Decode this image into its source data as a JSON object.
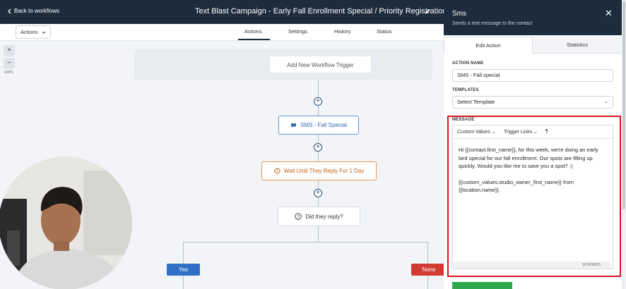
{
  "topbar": {
    "back_label": "Back to workflows",
    "title": "Text Blast Campaign - Early Fall Enrollment Special / Priority Registration"
  },
  "subbar": {
    "actions_label": "Actions",
    "tabs": [
      "Actions",
      "Settings",
      "History",
      "Status"
    ]
  },
  "zoom": {
    "plus": "+",
    "minus": "−",
    "level": "100%"
  },
  "canvas": {
    "trigger_label": "Add New Workflow Trigger",
    "nodes": {
      "sms": "SMS - Fall Special",
      "wait": "Wait Until They Reply For 1 Day",
      "condition": "Did they reply?"
    },
    "branches": {
      "yes": "Yes",
      "none": "None"
    },
    "colors": {
      "yes": "#2f6fc4",
      "none": "#d13b33"
    }
  },
  "panel": {
    "title": "Sms",
    "subtitle": "Sends a text message to the contact",
    "tabs": [
      "Edit Action",
      "Statistics"
    ],
    "action_name_label": "ACTION NAME",
    "action_name_value": "SMS - Fall special",
    "templates_label": "TEMPLATES",
    "templates_value": "Select Template",
    "message_label": "MESSAGE",
    "toolbar": {
      "custom_values": "Custom Values",
      "trigger_links": "Trigger Links",
      "paragraph": "¶"
    },
    "message_p1": "Hi {{contact.first_name}}, for this week, we're doing an early bird special for our fall enrollment. Our spots are filling up quickly. Would you like me to save you a spot? :)",
    "message_p2": "{{custom_values.studio_owner_first_name}} from {{location.name}}.",
    "word_count": "33 WORDS"
  }
}
